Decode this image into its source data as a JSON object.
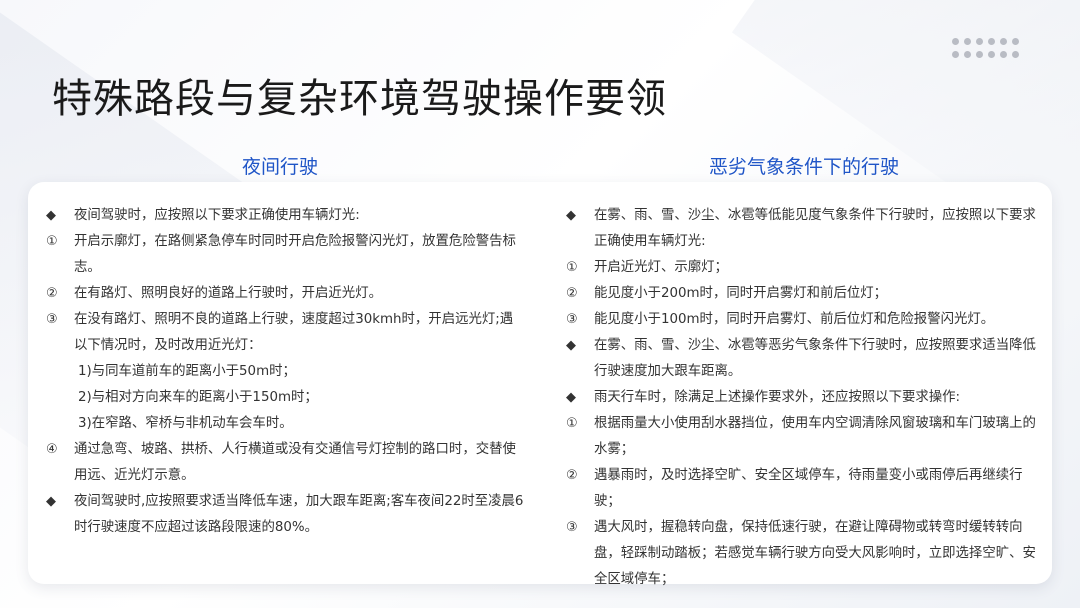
{
  "title": "特殊路段与复杂环境驾驶操作要领",
  "left": {
    "heading": "夜间行驶",
    "items": [
      {
        "marker": "◆",
        "text": "夜间驾驶时，应按照以下要求正确使用车辆灯光:"
      },
      {
        "marker": "①",
        "text": "开启示廓灯，在路侧紧急停车时同时开启危险报警闪光灯，放置危险警告标志。"
      },
      {
        "marker": "②",
        "text": "在有路灯、照明良好的道路上行驶时，开启近光灯。"
      },
      {
        "marker": "③",
        "text": "在没有路灯、照明不良的道路上行驶，速度超过30kmh时，开启远光灯;遇以下情况时，及时改用近光灯："
      },
      {
        "sub": "1)与同车道前车的距离小于50m时；"
      },
      {
        "sub": "2)与相对方向来车的距离小于150m时；"
      },
      {
        "sub": "3)在窄路、窄桥与非机动车会车时。"
      },
      {
        "marker": "④",
        "text": "通过急弯、坡路、拱桥、人行横道或没有交通信号灯控制的路口时，交替使用远、近光灯示意。"
      },
      {
        "marker": "◆",
        "text": "夜间驾驶时,应按照要求适当降低车速，加大跟车距离;客车夜间22时至凌晨6时行驶速度不应超过该路段限速的80%。"
      }
    ]
  },
  "right": {
    "heading": "恶劣气象条件下的行驶",
    "items": [
      {
        "marker": "◆",
        "text": "在雾、雨、雪、沙尘、冰雹等低能见度气象条件下行驶时，应按照以下要求正确使用车辆灯光:"
      },
      {
        "marker": "①",
        "text": "开启近光灯、示廓灯；"
      },
      {
        "marker": "②",
        "text": "能见度小于200m时，同时开启雾灯和前后位灯；"
      },
      {
        "marker": "③",
        "text": "能见度小于100m时，同时开启雾灯、前后位灯和危险报警闪光灯。"
      },
      {
        "marker": "◆",
        "text": "在雾、雨、雪、沙尘、冰雹等恶劣气象条件下行驶时，应按照要求适当降低行驶速度加大跟车距离。"
      },
      {
        "marker": "◆",
        "text": "雨天行车时，除满足上述操作要求外，还应按照以下要求操作:"
      },
      {
        "marker": "①",
        "text": "根据雨量大小使用刮水器挡位，使用车内空调清除风窗玻璃和车门玻璃上的水雾；"
      },
      {
        "marker": "②",
        "text": "遇暴雨时，及时选择空旷、安全区域停车，待雨量变小或雨停后再继续行驶；"
      },
      {
        "marker": "③",
        "text": "遇大风时，握稳转向盘，保持低速行驶，在避让障碍物或转弯时缓转转向盘，轻踩制动踏板；若感觉车辆行驶方向受大风影响时，立即选择空旷、安全区域停车；"
      }
    ]
  }
}
